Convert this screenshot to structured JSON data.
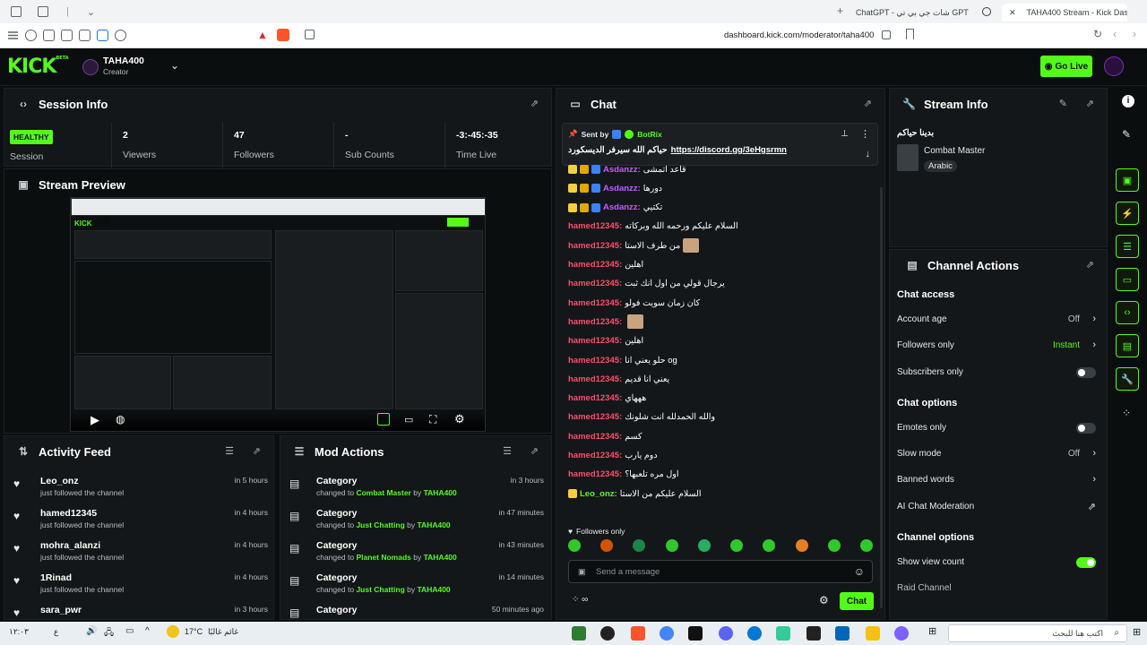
{
  "browser": {
    "tabs": [
      {
        "label": "ChatGPT - شات جي بي تي GPT"
      },
      {
        "label": "TAHA400 Stream - Kick Dashbo"
      }
    ],
    "url": "dashboard.kick.com/moderator/taha400"
  },
  "header": {
    "logo": "KICK",
    "logo_sup": "BETA",
    "channel_name": "TAHA400",
    "channel_role": "Creator",
    "go_live_label": "Go Live"
  },
  "session_info": {
    "title": "Session Info",
    "status_badge": "HEALTHY",
    "status_label": "Session",
    "stats": [
      {
        "value": "2",
        "label": "Viewers"
      },
      {
        "value": "47",
        "label": "Followers"
      },
      {
        "value": "-",
        "label": "Sub Counts"
      },
      {
        "value": "-3:-45:-35",
        "label": "Time Live"
      }
    ]
  },
  "stream_preview": {
    "title": "Stream Preview"
  },
  "activity_feed": {
    "title": "Activity Feed",
    "items": [
      {
        "name": "Leo_onz",
        "desc": "just followed the channel",
        "time": "in 5 hours"
      },
      {
        "name": "hamed12345",
        "desc": "just followed the channel",
        "time": "in 4 hours"
      },
      {
        "name": "mohra_alanzi",
        "desc": "just followed the channel",
        "time": "in 4 hours"
      },
      {
        "name": "1Rinad",
        "desc": "just followed the channel",
        "time": "in 4 hours"
      },
      {
        "name": "sara_pwr",
        "desc": "",
        "time": "in 3 hours"
      }
    ]
  },
  "mod_actions": {
    "title": "Mod Actions",
    "items": [
      {
        "title": "Category",
        "pre": "changed to",
        "value": "Combat Master",
        "by": "by",
        "user": "TAHA400",
        "time": "in 3 hours"
      },
      {
        "title": "Category",
        "pre": "changed to",
        "value": "Just Chatting",
        "by": "by",
        "user": "TAHA400",
        "time": "in 47 minutes"
      },
      {
        "title": "Category",
        "pre": "changed to",
        "value": "Planet Nomads",
        "by": "by",
        "user": "TAHA400",
        "time": "in 43 minutes"
      },
      {
        "title": "Category",
        "pre": "changed to",
        "value": "Just Chatting",
        "by": "by",
        "user": "TAHA400",
        "time": "in 14 minutes"
      },
      {
        "title": "Category",
        "pre": "",
        "value": "",
        "by": "",
        "user": "",
        "time": "50 minutes ago"
      }
    ]
  },
  "chat": {
    "title": "Chat",
    "pinned": {
      "sent_by_label": "Sent by",
      "sender": "BotRix",
      "text": "حياكم الله سيرفر الديسكورد",
      "link": "https://discord.gg/3eHgsrmn"
    },
    "messages": [
      {
        "user": "Asdanzz",
        "text": "قاعد اتمشى",
        "color": "#c45cff"
      },
      {
        "user": "Asdanzz",
        "text": "دورها",
        "color": "#c45cff"
      },
      {
        "user": "Asdanzz",
        "text": "تكتيي",
        "color": "#c45cff"
      },
      {
        "user": "hamed12345",
        "text": "السلام عليكم ورحمه الله وبركاته",
        "color": "#ff4d6d"
      },
      {
        "user": "hamed12345",
        "text": "من طرف الاستا",
        "color": "#ff4d6d"
      },
      {
        "user": "hamed12345",
        "text": "اهلين",
        "color": "#ff4d6d"
      },
      {
        "user": "hamed12345",
        "text": "يرجال قولي من اول انك ثبت",
        "color": "#ff4d6d"
      },
      {
        "user": "hamed12345",
        "text": "كان زمان سويت فولو",
        "color": "#ff4d6d"
      },
      {
        "user": "hamed12345",
        "text": "",
        "color": "#ff4d6d"
      },
      {
        "user": "hamed12345",
        "text": "اهلين",
        "color": "#ff4d6d"
      },
      {
        "user": "hamed12345",
        "text": "حلو يعني انا og",
        "color": "#ff4d6d"
      },
      {
        "user": "hamed12345",
        "text": "يعني انا قديم",
        "color": "#ff4d6d"
      },
      {
        "user": "hamed12345",
        "text": "هههاي",
        "color": "#ff4d6d"
      },
      {
        "user": "hamed12345",
        "text": "والله الحمدلله انت شلونك",
        "color": "#ff4d6d"
      },
      {
        "user": "hamed12345",
        "text": "كسم",
        "color": "#ff4d6d"
      },
      {
        "user": "hamed12345",
        "text": "دوم يارب",
        "color": "#ff4d6d"
      },
      {
        "user": "hamed12345",
        "text": "اول مره تلعبها؟",
        "color": "#ff4d6d"
      },
      {
        "user": "Leo_onz",
        "text": "السلام عليكم من الاستا",
        "color": "#53fc18"
      }
    ],
    "followers_only_label": "Followers only",
    "input_placeholder": "Send a message",
    "send_label": "Chat"
  },
  "stream_info": {
    "title": "Stream Info",
    "stream_title": "بدينا حياكم",
    "category": "Combat Master",
    "language_tag": "Arabic"
  },
  "channel_actions": {
    "title": "Channel Actions",
    "chat_access_label": "Chat access",
    "account_age": {
      "label": "Account age",
      "value": "Off"
    },
    "followers_only": {
      "label": "Followers only",
      "value": "Instant"
    },
    "subscribers_only": {
      "label": "Subscribers only"
    },
    "chat_options_label": "Chat options",
    "emotes_only": {
      "label": "Emotes only"
    },
    "slow_mode": {
      "label": "Slow mode",
      "value": "Off"
    },
    "banned_words": {
      "label": "Banned words"
    },
    "ai_moderation": {
      "label": "AI Chat Moderation"
    },
    "channel_options_label": "Channel options",
    "show_view_count": {
      "label": "Show view count"
    },
    "raid_channel": {
      "label": "Raid Channel"
    }
  },
  "taskbar": {
    "weather": "17°C",
    "weather_desc": "غائم غالبًا",
    "search_placeholder": "اكتب هنا للبحث",
    "clock": "١٢:٠٣"
  },
  "colors": {
    "accent": "#53fc18",
    "panel_bg": "#141719",
    "page_bg": "#0b0e0f",
    "chat_user_hamed": "#ff4d6d",
    "chat_user_asdanzz": "#c45cff"
  }
}
